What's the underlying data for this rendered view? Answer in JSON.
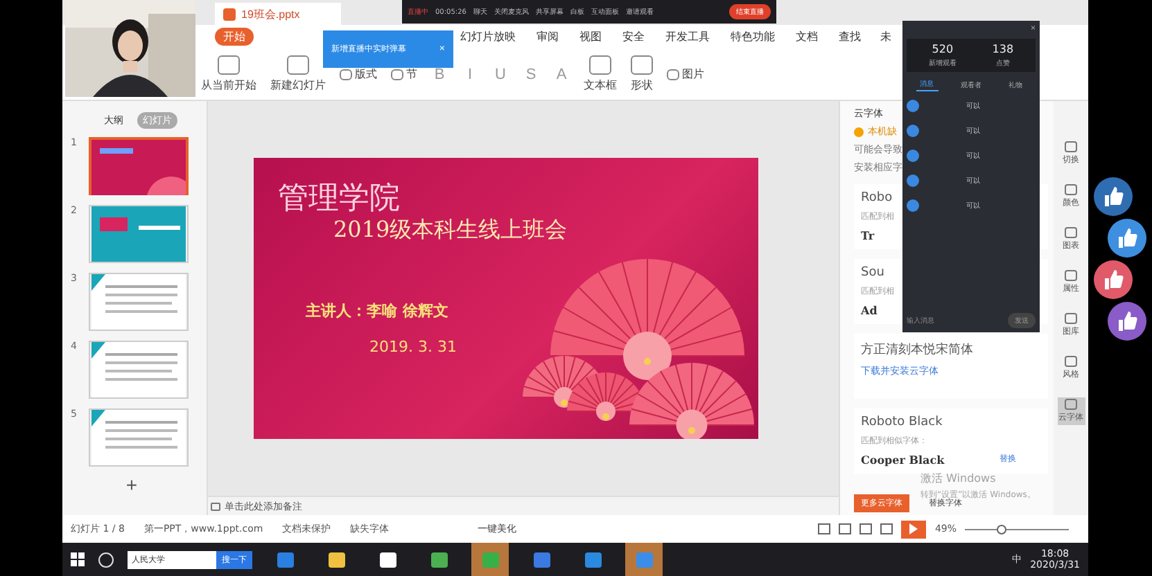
{
  "share_bar": {
    "items": [
      "直播中",
      "00:05:26",
      "聊天",
      "关闭麦克风",
      "共享屏幕",
      "白板",
      "互动面板",
      "邀请观看"
    ],
    "end_button": "结束直播"
  },
  "title_bar": {
    "tabs": [
      {
        "label": "19班会.pptx",
        "selected": true
      }
    ]
  },
  "menu": [
    {
      "label": "开始",
      "selected": true
    },
    {
      "label": "幻灯片放映",
      "selected": false
    },
    {
      "label": "审阅",
      "selected": false
    },
    {
      "label": "视图",
      "selected": false
    },
    {
      "label": "安全",
      "selected": false
    },
    {
      "label": "开发工具",
      "selected": false
    },
    {
      "label": "特色功能",
      "selected": false
    },
    {
      "label": "文档",
      "selected": false
    }
  ],
  "menu_right": [
    "查找",
    "未"
  ],
  "tooltip": {
    "text": "新增直播中实时弹幕",
    "close": "×"
  },
  "toolbar": [
    {
      "kind": "big",
      "label": "从当前开始"
    },
    {
      "kind": "big",
      "label": "新建幻灯片"
    },
    {
      "kind": "small",
      "label": "版式"
    },
    {
      "kind": "small",
      "label": "节"
    },
    {
      "kind": "format",
      "label": "B"
    },
    {
      "kind": "format",
      "label": "I"
    },
    {
      "kind": "format",
      "label": "U"
    },
    {
      "kind": "format",
      "label": "S"
    },
    {
      "kind": "format",
      "label": "A"
    },
    {
      "kind": "big",
      "label": "文本框"
    },
    {
      "kind": "big",
      "label": "形状"
    },
    {
      "kind": "small",
      "label": "图片"
    }
  ],
  "left_panel": {
    "tabs": [
      {
        "label": "大纲",
        "selected": false
      },
      {
        "label": "幻灯片",
        "selected": true
      }
    ],
    "slides": [
      {
        "number": "1",
        "kind": "title",
        "selected": true
      },
      {
        "number": "2",
        "kind": "teal",
        "selected": false
      },
      {
        "number": "3",
        "kind": "doc",
        "selected": false
      },
      {
        "number": "4",
        "kind": "doc",
        "selected": false
      },
      {
        "number": "5",
        "kind": "doc",
        "selected": false
      }
    ],
    "add": "+"
  },
  "slide": {
    "title": "管理学院",
    "subtitle": "2019级本科生线上班会",
    "speakers": "主讲人：李喻  徐辉文",
    "date": "2019. 3. 31"
  },
  "notes": "单击此处添加备注",
  "font_pane": {
    "header": "云字体",
    "warning": "本机缺",
    "note_lines": [
      "可能会导致",
      "安装相应字"
    ],
    "cards": [
      {
        "name": "Robo",
        "hint": "匹配到相",
        "match": "Tr"
      },
      {
        "name": "Sou",
        "hint": "匹配到相",
        "match": "Ad"
      },
      {
        "name": "方正清刻本悦宋简体",
        "link": "下载并安装云字体"
      },
      {
        "name": "Roboto Black",
        "hint": "匹配到相似字体：",
        "match": "Cooper Black",
        "action": "替换"
      }
    ],
    "more_button": "更多云字体",
    "replace_button": "替换字体"
  },
  "side_tools": [
    {
      "label": "切换",
      "selected": false
    },
    {
      "label": "颜色",
      "selected": false
    },
    {
      "label": "图表",
      "selected": false
    },
    {
      "label": "属性",
      "selected": false
    },
    {
      "label": "图库",
      "selected": false
    },
    {
      "label": "风格",
      "selected": false
    },
    {
      "label": "云字体",
      "selected": true
    }
  ],
  "chat": {
    "stats": [
      {
        "value": "520",
        "label": "新增观看"
      },
      {
        "value": "138",
        "label": "点赞"
      }
    ],
    "tabs": [
      {
        "label": "消息",
        "selected": true
      },
      {
        "label": "观看者",
        "selected": false
      },
      {
        "label": "礼物",
        "selected": false
      }
    ],
    "close": "×",
    "messages": [
      "可以",
      "可以",
      "可以",
      "可以",
      "可以"
    ],
    "input_placeholder": "输入消息",
    "send": "发送"
  },
  "likes": [
    {
      "color": "#2f6db3"
    },
    {
      "color": "#3f8fe0"
    },
    {
      "color": "#e05a6a"
    },
    {
      "color": "#8a5cc7"
    }
  ],
  "activation": [
    "激活 Windows",
    "转到“设置”以激活 Windows。"
  ],
  "status_bar": {
    "slide": "幻灯片 1 / 8",
    "template": "第一PPT，www.1ppt.com",
    "protect": "文档未保护",
    "fonts": "缺失字体",
    "beautify": "一键美化",
    "zoom": "49%",
    "level": 0.3
  },
  "taskbar": {
    "search": "人民大学",
    "search_button": "搜一下",
    "apps": [
      {
        "active": false
      },
      {
        "active": false
      },
      {
        "active": false
      },
      {
        "active": false
      },
      {
        "active": true
      },
      {
        "active": false
      },
      {
        "active": false
      },
      {
        "active": true
      }
    ],
    "time": "18:08",
    "date": "2020/3/31",
    "ime": "中"
  }
}
